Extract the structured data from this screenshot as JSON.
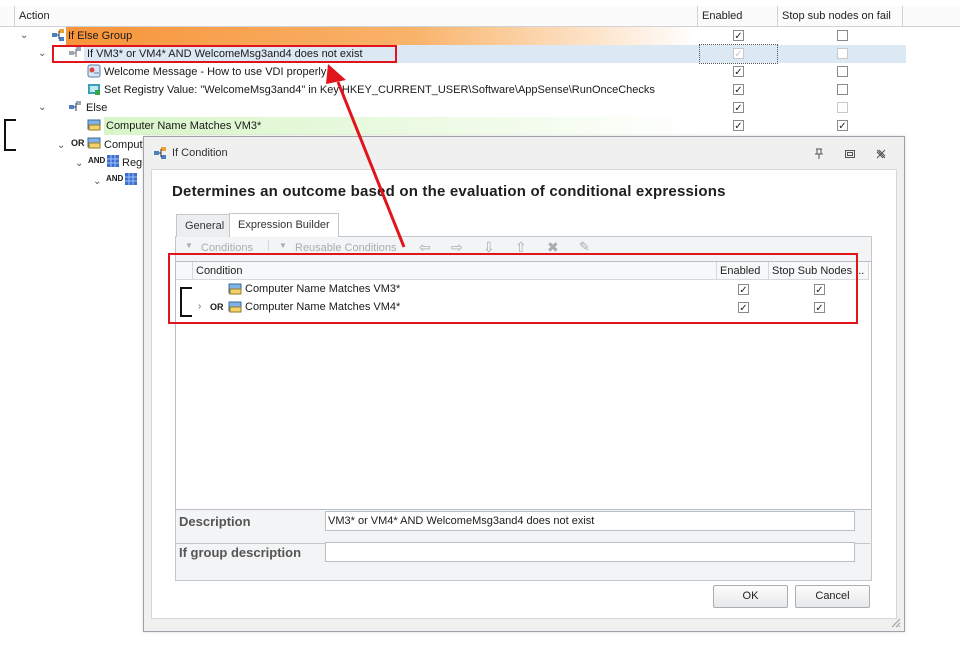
{
  "tree": {
    "headers": {
      "action": "Action",
      "enabled": "Enabled",
      "stop": "Stop sub nodes on fail"
    },
    "rows": [
      {
        "label": "If Else Group",
        "enabled": true,
        "stop": false
      },
      {
        "label": "If VM3* or VM4* AND WelcomeMsg3and4 does not exist",
        "enabled": true,
        "stop": false
      },
      {
        "label": "Welcome Message - How to use VDI properly",
        "enabled": true,
        "stop": false
      },
      {
        "label": "Set Registry Value: \"WelcomeMsg3and4\" in Key HKEY_CURRENT_USER\\Software\\AppSense\\RunOnceChecks",
        "enabled": true,
        "stop": false
      },
      {
        "label": "Else",
        "enabled": true,
        "stop": false
      },
      {
        "label": "Computer Name Matches VM3*",
        "enabled": true,
        "stop": true
      },
      {
        "label": "Comput",
        "op": "OR"
      },
      {
        "label": "Reg",
        "op": "AND"
      },
      {
        "label": "",
        "op": "AND"
      }
    ],
    "checkmark": "✓"
  },
  "dialog": {
    "title": "If Condition",
    "heading": "Determines an outcome based on the evaluation of conditional expressions",
    "tabs": [
      "General",
      "Expression Builder"
    ],
    "toolbar": {
      "conditions": "Conditions",
      "reusable": "Reusable Conditions"
    },
    "grid": {
      "headers": {
        "condition": "Condition",
        "enabled": "Enabled",
        "stop": "Stop Sub Nodes ..."
      },
      "rows": [
        {
          "op": "",
          "label": "Computer Name Matches VM3*",
          "enabled": true,
          "stop": true
        },
        {
          "op": "OR",
          "label": "Computer Name Matches VM4*",
          "enabled": true,
          "stop": true
        }
      ]
    },
    "description_label": "Description",
    "description_value": "VM3* or VM4* AND WelcomeMsg3and4 does not exist",
    "group_description_label": "If group description",
    "group_description_value": "",
    "ok": "OK",
    "cancel": "Cancel"
  },
  "colors": {
    "accent_orange": "#f7943a",
    "highlight_green": "#d8f5c8",
    "annotation_red": "#e0141a",
    "selected_row": "#dde8f5"
  }
}
